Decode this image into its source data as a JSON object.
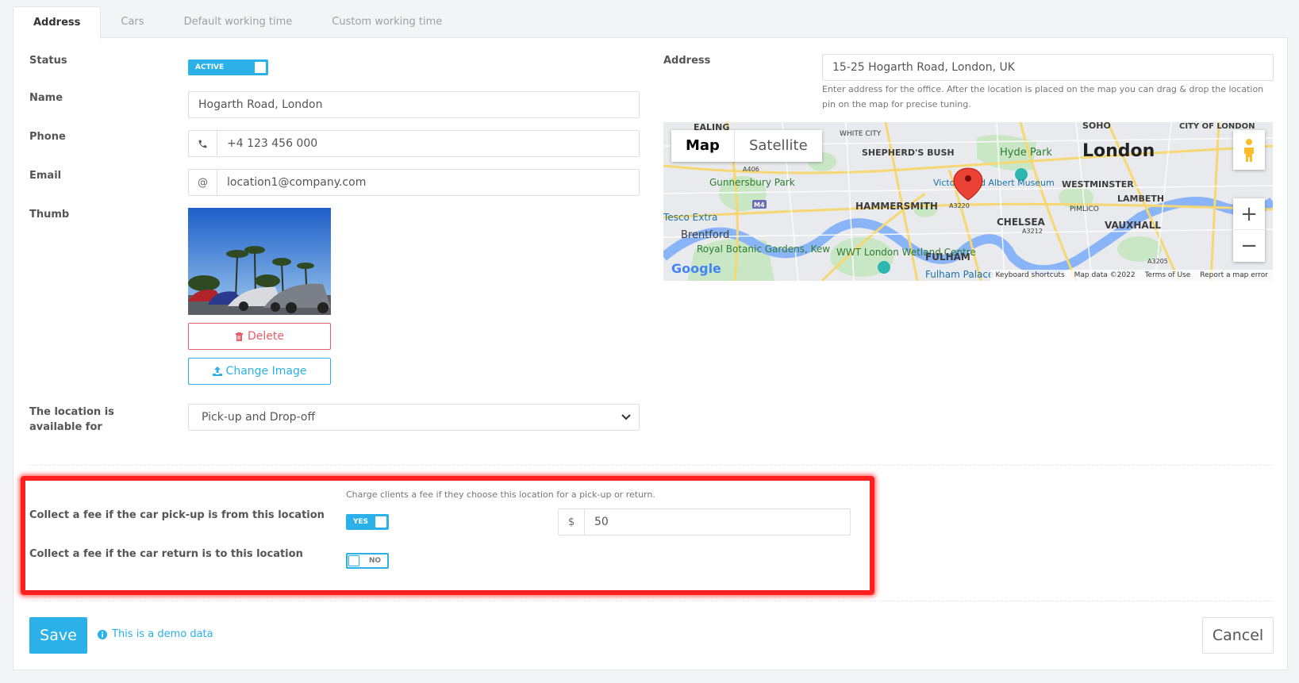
{
  "tabs": [
    "Address",
    "Cars",
    "Default working time",
    "Custom working time"
  ],
  "form": {
    "status_label": "Status",
    "status_toggle": "ACTIVE",
    "name_label": "Name",
    "name_value": "Hogarth Road, London",
    "phone_label": "Phone",
    "phone_value": "+4 123 456 000",
    "email_label": "Email",
    "email_addon": "@",
    "email_value": "location1@company.com",
    "thumb_label": "Thumb",
    "delete_label": "Delete",
    "change_image_label": "Change Image",
    "availability_label": "The location is available for",
    "availability_value": "Pick-up and Drop-off",
    "address_label": "Address",
    "address_value": "15-25 Hogarth Road, London, UK",
    "address_help": "Enter address for the office. After the location is placed on the map you can drag & drop the location pin on the map for precise tuning."
  },
  "map": {
    "type_map": "Map",
    "type_satellite": "Satellite",
    "zoom_in": "+",
    "zoom_out": "−",
    "labels": {
      "ealing": "EALING",
      "white_city": "WHITE CITY",
      "shepherds_bush": "SHEPHERD'S BUSH",
      "soho": "SOHO",
      "city_of_london": "CITY OF LONDON",
      "london": "London",
      "hyde_park": "Hyde Park",
      "gunnersbury_park": "Gunnersbury Park",
      "victoria_albert": "Victoria and Albert Museum",
      "westminster": "WESTMINSTER",
      "lambeth": "LAMBETH",
      "hammersmith": "HAMMERSMITH",
      "pimlico": "PIMLICO",
      "tesco_extra": "Tesco Extra",
      "chelsea": "CHELSEA",
      "vauxhall": "VAUXHALL",
      "brentford": "Brentford",
      "royal_botanic": "Royal Botanic Gardens, Kew",
      "wwt_london": "WWT London Wetland Centre",
      "fulham": "FULHAM",
      "fulham_palace": "Fulham Palace",
      "m4": "M4",
      "a3212": "A3212",
      "a3205": "A3205",
      "a3220": "A3220",
      "a406": "A406",
      "google": "Google"
    },
    "attribution": [
      "Keyboard shortcuts",
      "Map data ©2022",
      "Terms of Use",
      "Report a map error"
    ]
  },
  "fees": {
    "help": "Charge clients a fee if they choose this location for a pick-up or return.",
    "pickup_label": "Collect a fee if the car pick-up is from this location",
    "pickup_toggle": "YES",
    "currency": "$",
    "amount": "50",
    "return_label": "Collect a fee if the car return is to this location",
    "return_toggle": "NO"
  },
  "footer": {
    "save": "Save",
    "demo": "This is a demo data",
    "cancel": "Cancel"
  },
  "colors": {
    "accent": "#2bb1e8",
    "danger": "#e35d6a",
    "highlight": "#ff1f1f"
  }
}
